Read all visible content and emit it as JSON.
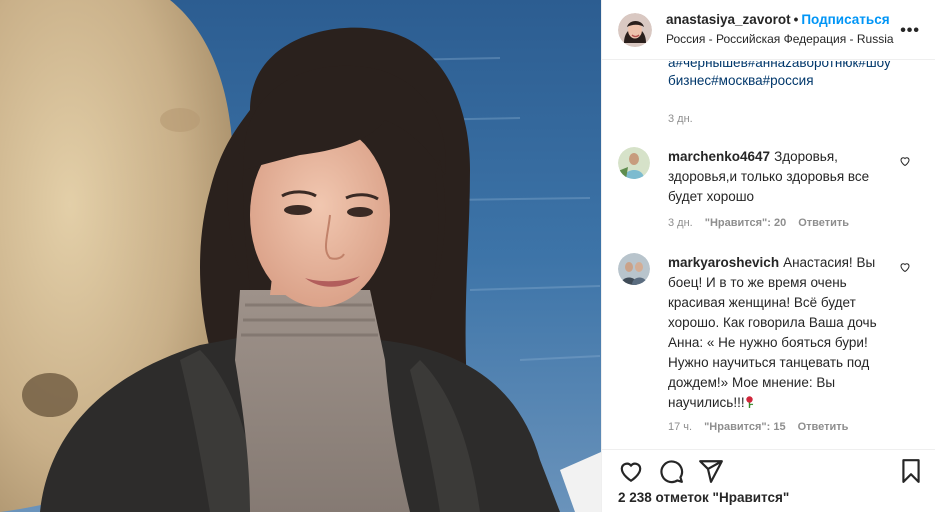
{
  "post": {
    "username": "anastasiya_zavorot",
    "separator": "•",
    "follow_label": "Подписаться",
    "location": "Россия - Российская Федерация - Russia",
    "more_label": "•••"
  },
  "caption": {
    "hashtags_line1": "а#чернышев#аннazaворотнюк#шоу",
    "hashtags_line2": "бизнес#москва#россия",
    "time": "3 дн."
  },
  "comments": [
    {
      "username": "marchenko4647",
      "text": "Здоровья, здоровья,и только здоровья все будет хорошо",
      "time": "3 дн.",
      "likes": "\"Нравится\": 20",
      "reply": "Ответить"
    },
    {
      "username": "markyaroshevich",
      "text": "Анастасия! Вы боец! И в то же время очень красивая женщина! Всё будет хорошо. Как говорила Ваша дочь Анна: « Не нужно бояться бури! Нужно научиться танцевать под дождем!» Мое мнение: Вы научились!!!",
      "time": "17 ч.",
      "likes": "\"Нравится\": 15",
      "reply": "Ответить"
    }
  ],
  "likes_count": "2 238 отметок \"Нравится\"",
  "icons": [
    "heart-icon",
    "comment-icon",
    "share-icon",
    "bookmark-icon",
    "more-icon",
    "rose-emoji-icon"
  ],
  "colors": {
    "link": "#0095f6",
    "hashtag": "#00376b",
    "muted": "#8e8e8e"
  }
}
